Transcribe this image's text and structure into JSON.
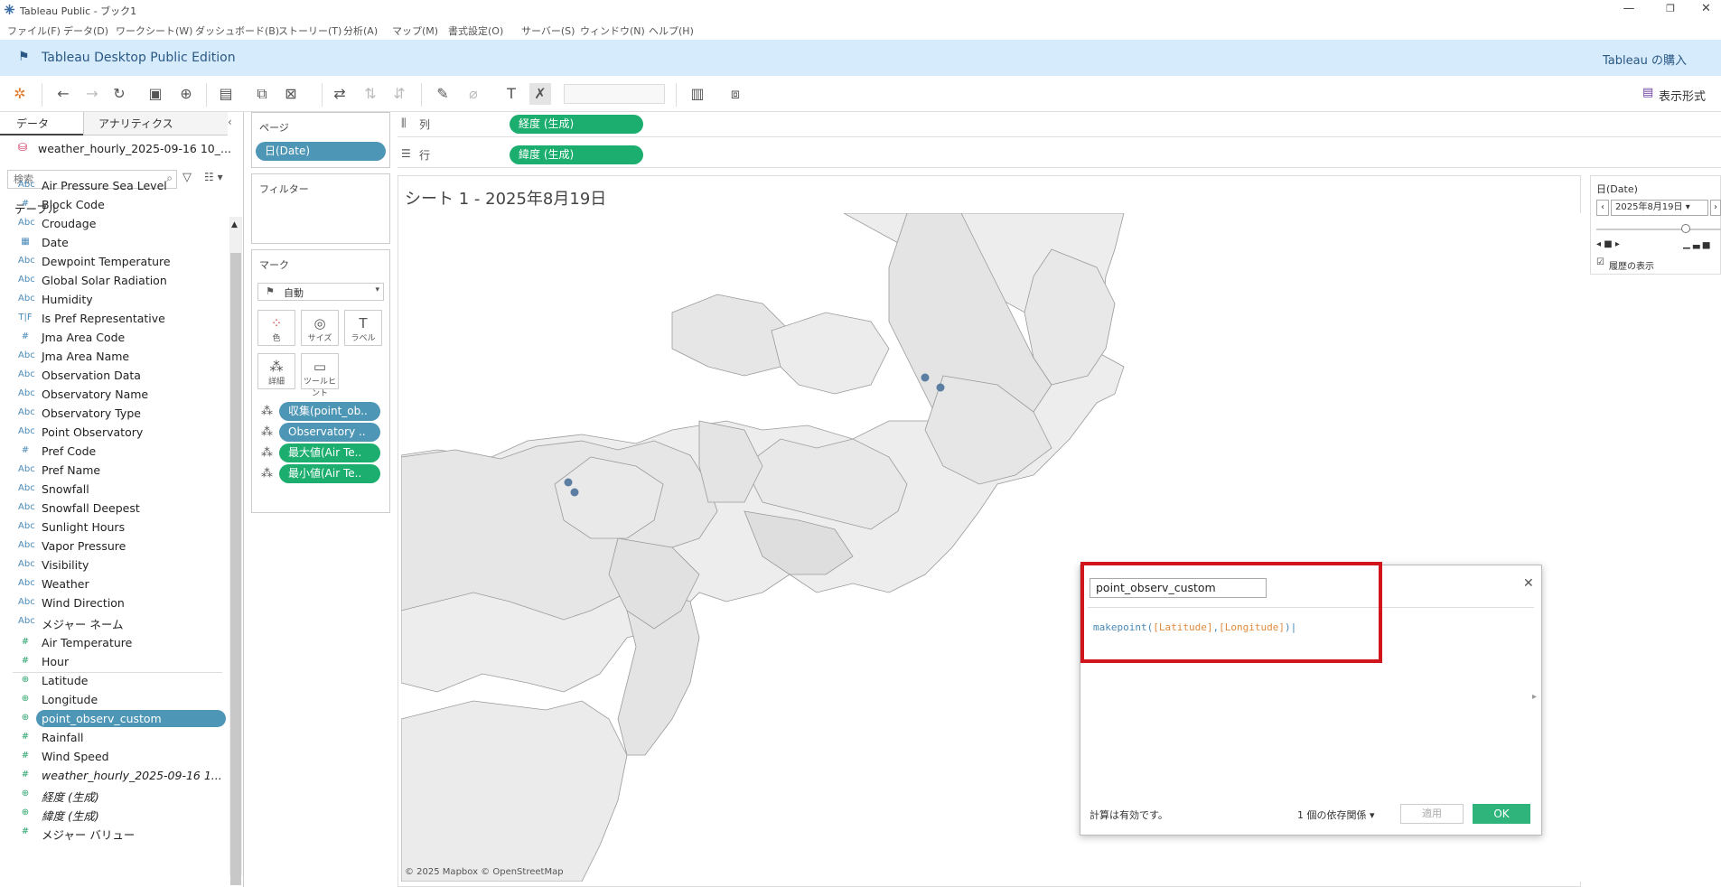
{
  "window": {
    "title": "Tableau Public - ブック1"
  },
  "menu": [
    "ファイル(F)",
    "データ(D)",
    "ワークシート(W)",
    "ダッシュボード(B)",
    "ストーリー(T)",
    "分析(A)",
    "マップ(M)",
    "書式設定(O)",
    "サーバー(S)",
    "ウィンドウ(N)",
    "ヘルプ(H)"
  ],
  "banner": {
    "title": "Tableau Desktop Public Edition",
    "buy": "Tableau の購入"
  },
  "toolbar": {
    "show_me": "表示形式"
  },
  "data_pane": {
    "tab_data": "データ",
    "tab_analytics": "アナリティクス",
    "source": "weather_hourly_2025-09-16 10_...",
    "search_placeholder": "検索",
    "section_tables": "テーブル",
    "dimensions": [
      {
        "icon": "Abc",
        "name": "Air Pressure Sea Level"
      },
      {
        "icon": "#",
        "name": "Block Code"
      },
      {
        "icon": "Abc",
        "name": "Croudage"
      },
      {
        "icon": "cal",
        "name": "Date"
      },
      {
        "icon": "Abc",
        "name": "Dewpoint Temperature"
      },
      {
        "icon": "Abc",
        "name": "Global Solar Radiation"
      },
      {
        "icon": "Abc",
        "name": "Humidity"
      },
      {
        "icon": "T|F",
        "name": "Is Pref Representative"
      },
      {
        "icon": "#",
        "name": "Jma Area Code"
      },
      {
        "icon": "Abc",
        "name": "Jma Area Name"
      },
      {
        "icon": "Abc",
        "name": "Observation Data"
      },
      {
        "icon": "Abc",
        "name": "Observatory Name"
      },
      {
        "icon": "Abc",
        "name": "Observatory Type"
      },
      {
        "icon": "Abc",
        "name": "Point Observatory"
      },
      {
        "icon": "#",
        "name": "Pref Code"
      },
      {
        "icon": "Abc",
        "name": "Pref Name"
      },
      {
        "icon": "Abc",
        "name": "Snowfall"
      },
      {
        "icon": "Abc",
        "name": "Snowfall Deepest"
      },
      {
        "icon": "Abc",
        "name": "Sunlight Hours"
      },
      {
        "icon": "Abc",
        "name": "Vapor Pressure"
      },
      {
        "icon": "Abc",
        "name": "Visibility"
      },
      {
        "icon": "Abc",
        "name": "Weather"
      },
      {
        "icon": "Abc",
        "name": "Wind Direction"
      },
      {
        "icon": "Abc",
        "name": "メジャー ネーム"
      }
    ],
    "measures": [
      {
        "icon": "#",
        "name": "Air Temperature"
      },
      {
        "icon": "#",
        "name": "Hour"
      },
      {
        "icon": "globe",
        "name": "Latitude"
      },
      {
        "icon": "globe",
        "name": "Longitude"
      },
      {
        "icon": "globe",
        "name": "point_observ_custom"
      },
      {
        "icon": "#",
        "name": "Rainfall"
      },
      {
        "icon": "#",
        "name": "Wind Speed"
      },
      {
        "icon": "#",
        "name": "weather_hourly_2025-09-16 1..."
      },
      {
        "icon": "globe",
        "name": "経度 (生成)"
      },
      {
        "icon": "globe",
        "name": "緯度 (生成)"
      },
      {
        "icon": "#",
        "name": "メジャー バリュー"
      }
    ]
  },
  "pages": {
    "title": "ページ",
    "pill": "日(Date)"
  },
  "filters": {
    "title": "フィルター"
  },
  "marks": {
    "title": "マーク",
    "type": "自動",
    "buttons": [
      "色",
      "サイズ",
      "ラベル",
      "詳細",
      "ツールヒント"
    ],
    "pills": [
      "収集(point_ob..",
      "Observatory ..",
      "最大値(Air Te..",
      "最小値(Air Te.."
    ]
  },
  "shelves": {
    "columns_label": "列",
    "columns_pill": "経度 (生成)",
    "rows_label": "行",
    "rows_pill": "緯度 (生成)"
  },
  "sheet": {
    "title": "シート 1 - 2025年8月19日",
    "credit": "© 2025 Mapbox © OpenStreetMap"
  },
  "date_panel": {
    "title": "日(Date)",
    "value": "2025年8月19日",
    "history": "履歴の表示"
  },
  "calc_dialog": {
    "name": "point_observ_custom",
    "formula_func": "makepoint",
    "formula_arg1": "[Latitude]",
    "formula_arg2": "[Longitude]",
    "status": "計算は有効です。",
    "deps": "1 個の依存関係",
    "apply": "適用",
    "ok": "OK"
  }
}
